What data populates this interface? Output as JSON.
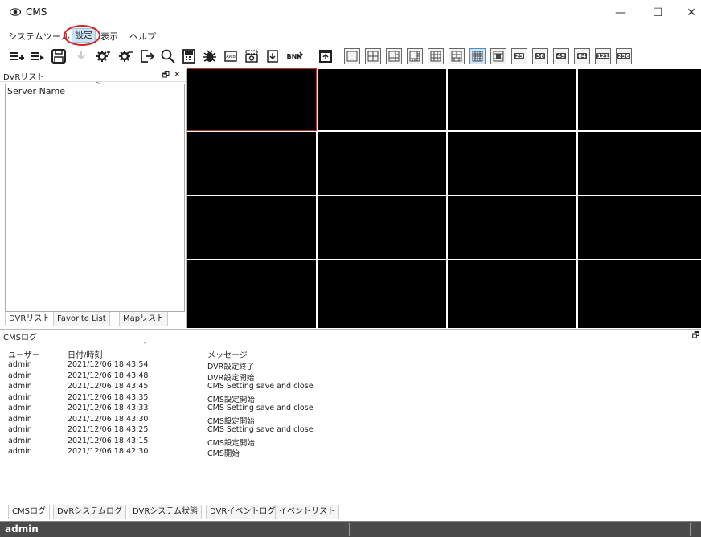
{
  "window": {
    "title": "CMS",
    "app_icon": "eye-icon",
    "minimize": "—",
    "maximize": "☐",
    "close": "✕"
  },
  "menu": {
    "items": [
      "システム",
      "ツール",
      "設定",
      "表示",
      "ヘルプ"
    ],
    "active_index": 2
  },
  "toolbar": {
    "tools": [
      "add-list-icon",
      "remove-list-icon",
      "save-icon",
      "download-icon",
      "settings-icon",
      "settings-alt-icon",
      "logout-icon",
      "search-icon",
      "calculator-icon",
      "bug-icon",
      "awb-icon",
      "snapshot-icon",
      "import-icon",
      "bnk-icon",
      "calendar-icon"
    ],
    "bnk_label": "BNK",
    "awb_label": "AWB",
    "layouts": [
      "1",
      "4",
      "6",
      "8",
      "9",
      "10",
      "16",
      "13",
      "25",
      "36",
      "49",
      "64",
      "121",
      "256"
    ],
    "active_layout_index": 6
  },
  "left_panel": {
    "title": "DVRリスト",
    "pin": "🗗",
    "close": "✕",
    "column_header": "Server Name",
    "tabs": [
      "DVRリスト",
      "Favorite List",
      "Mapリスト"
    ],
    "active_tab_index": 0
  },
  "log_panel": {
    "title": "CMSログ",
    "columns": {
      "user": "ユーザー",
      "date": "日付/時刻",
      "message": "メッセージ"
    },
    "rows": [
      {
        "user": "admin",
        "date": "2021/12/06 18:43:54",
        "message": "DVR設定終了"
      },
      {
        "user": "admin",
        "date": "2021/12/06 18:43:48",
        "message": "DVR設定開始"
      },
      {
        "user": "admin",
        "date": "2021/12/06 18:43:45",
        "message": "CMS Setting save and close"
      },
      {
        "user": "admin",
        "date": "2021/12/06 18:43:35",
        "message": "CMS設定開始"
      },
      {
        "user": "admin",
        "date": "2021/12/06 18:43:33",
        "message": "CMS Setting save and close"
      },
      {
        "user": "admin",
        "date": "2021/12/06 18:43:30",
        "message": "CMS設定開始"
      },
      {
        "user": "admin",
        "date": "2021/12/06 18:43:25",
        "message": "CMS Setting save and close"
      },
      {
        "user": "admin",
        "date": "2021/12/06 18:43:15",
        "message": "CMS設定開始"
      },
      {
        "user": "admin",
        "date": "2021/12/06 18:42:30",
        "message": "CMS開始"
      }
    ],
    "tabs": [
      "CMSログ",
      "DVRシステムログ",
      "DVRシステム状態",
      "DVRイベントログ",
      "イベントリスト"
    ],
    "active_tab_index": 0
  },
  "status": {
    "user": "admin"
  },
  "colors": {
    "highlight_circle": "#e02020",
    "status_bar": "#4b4b4b",
    "video_bg": "#000000"
  }
}
